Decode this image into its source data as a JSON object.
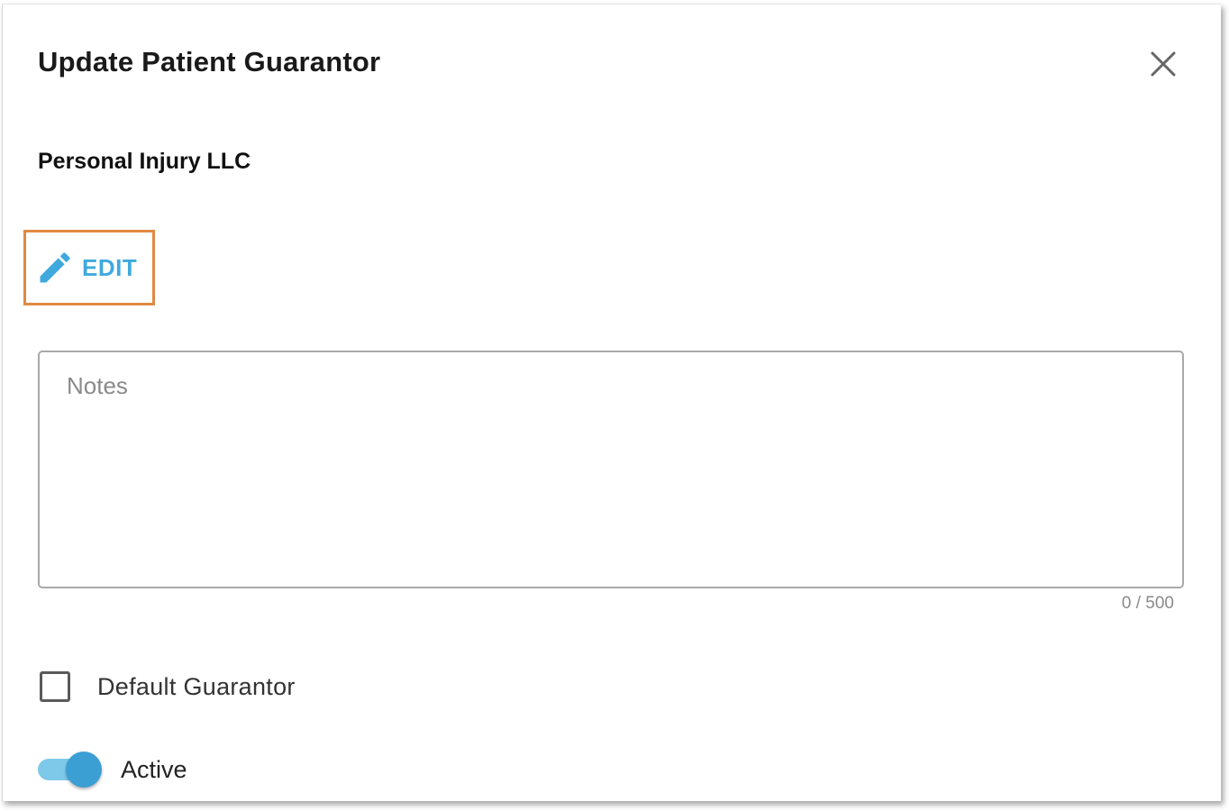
{
  "dialog": {
    "title": "Update Patient Guarantor",
    "close_icon": "close-icon",
    "guarantor_name": "Personal Injury LLC",
    "edit": {
      "label": "EDIT",
      "icon": "pencil-icon",
      "color": "#3fa9dd",
      "highlight_color": "#e08a44"
    },
    "notes": {
      "placeholder": "Notes",
      "value": "",
      "counter": "0 / 500"
    },
    "default_guarantor": {
      "label": "Default Guarantor",
      "checked": false
    },
    "active": {
      "label": "Active",
      "on": true,
      "color": "#3b9fd3"
    }
  }
}
